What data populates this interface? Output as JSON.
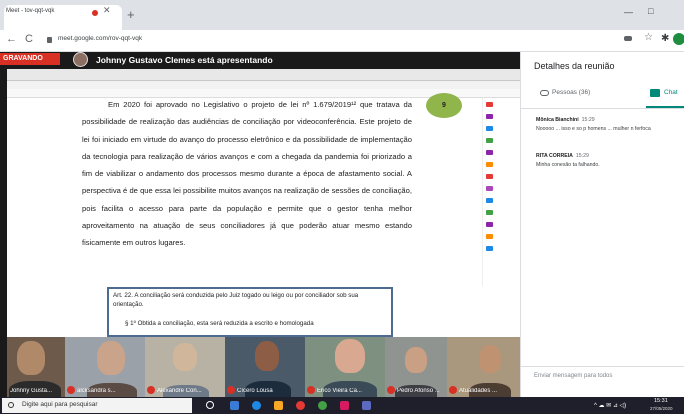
{
  "browser": {
    "tab_title": "Meet - tov-qqt-vqk",
    "tab_close": "✕",
    "new_tab": "+",
    "back": "←",
    "reload": "C",
    "url": "meet.google.com/rov-qqt-vqk",
    "window_min": "—",
    "window_max": "□"
  },
  "meet": {
    "recording_label": "GRAVANDO",
    "presenting_text": "Johnny Gustavo Clemes está apresentando",
    "document": {
      "paragraph": "Em 2020 foi aprovado no Legislativo o projeto de lei nº 1.679/2019¹² que tratava da possibilidade de realização das audiências de conciliação por videoconferência. Este projeto de lei foi iniciado em virtude do avanço do processo eletrônico e da possibilidade de implementação da tecnologia para realização de vários avanços e com a chegada da pandemia foi priorizado a fim de viabilizar o andamento dos processos mesmo durante a época de afastamento social. A perspectiva é de que essa lei possibilite muitos avanços na realização de sessões de conciliação, pois facilita o acesso para parte da população e permite que o gestor tenha melhor aproveitamento na atuação de seus conciliadores já que poderão atuar mesmo estando fisicamente em outros lugares.",
      "page_number": "9",
      "law_article": "Art. 22. A conciliação será conduzida pelo Juiz togado ou leigo ou por conciliador sob sua orientação.",
      "law_paragraph": "§ 1º Obtida a conciliação, esta será reduzida a escrito e homologada"
    },
    "participants": [
      {
        "name": "Johnny Gusta..."
      },
      {
        "name": "alcksandra s..."
      },
      {
        "name": "Alexandre Con..."
      },
      {
        "name": "Cícero Lousa"
      },
      {
        "name": "Erico Vieira Ca..."
      },
      {
        "name": "Pedro Afonso ..."
      },
      {
        "name": "Atualidades ..."
      }
    ]
  },
  "panel": {
    "title": "Detalhes da reunião",
    "people_tab": "Pessoas (36)",
    "chat_tab": "Chat",
    "messages": [
      {
        "sender": "Mônica Bianchini",
        "time": "15:29",
        "text": "Nooooo ... isso e so p homens ... mulher n ferfoca"
      },
      {
        "sender": "RITA CORREIA",
        "time": "15:29",
        "text": "Minha conexão ta falhando."
      }
    ],
    "input_placeholder": "Enviar mensagem para todos"
  },
  "taskbar": {
    "search_placeholder": "Digite aqui para pesquisar",
    "tray": "^ ☁ ✉ ⊿ ◁)",
    "time": "15:31",
    "date": "27/05/2020"
  },
  "colors": {
    "recording_red": "#d93025",
    "meet_teal": "#00897b",
    "page_badge": "#8fb54b",
    "law_border": "#4d6b8f"
  }
}
